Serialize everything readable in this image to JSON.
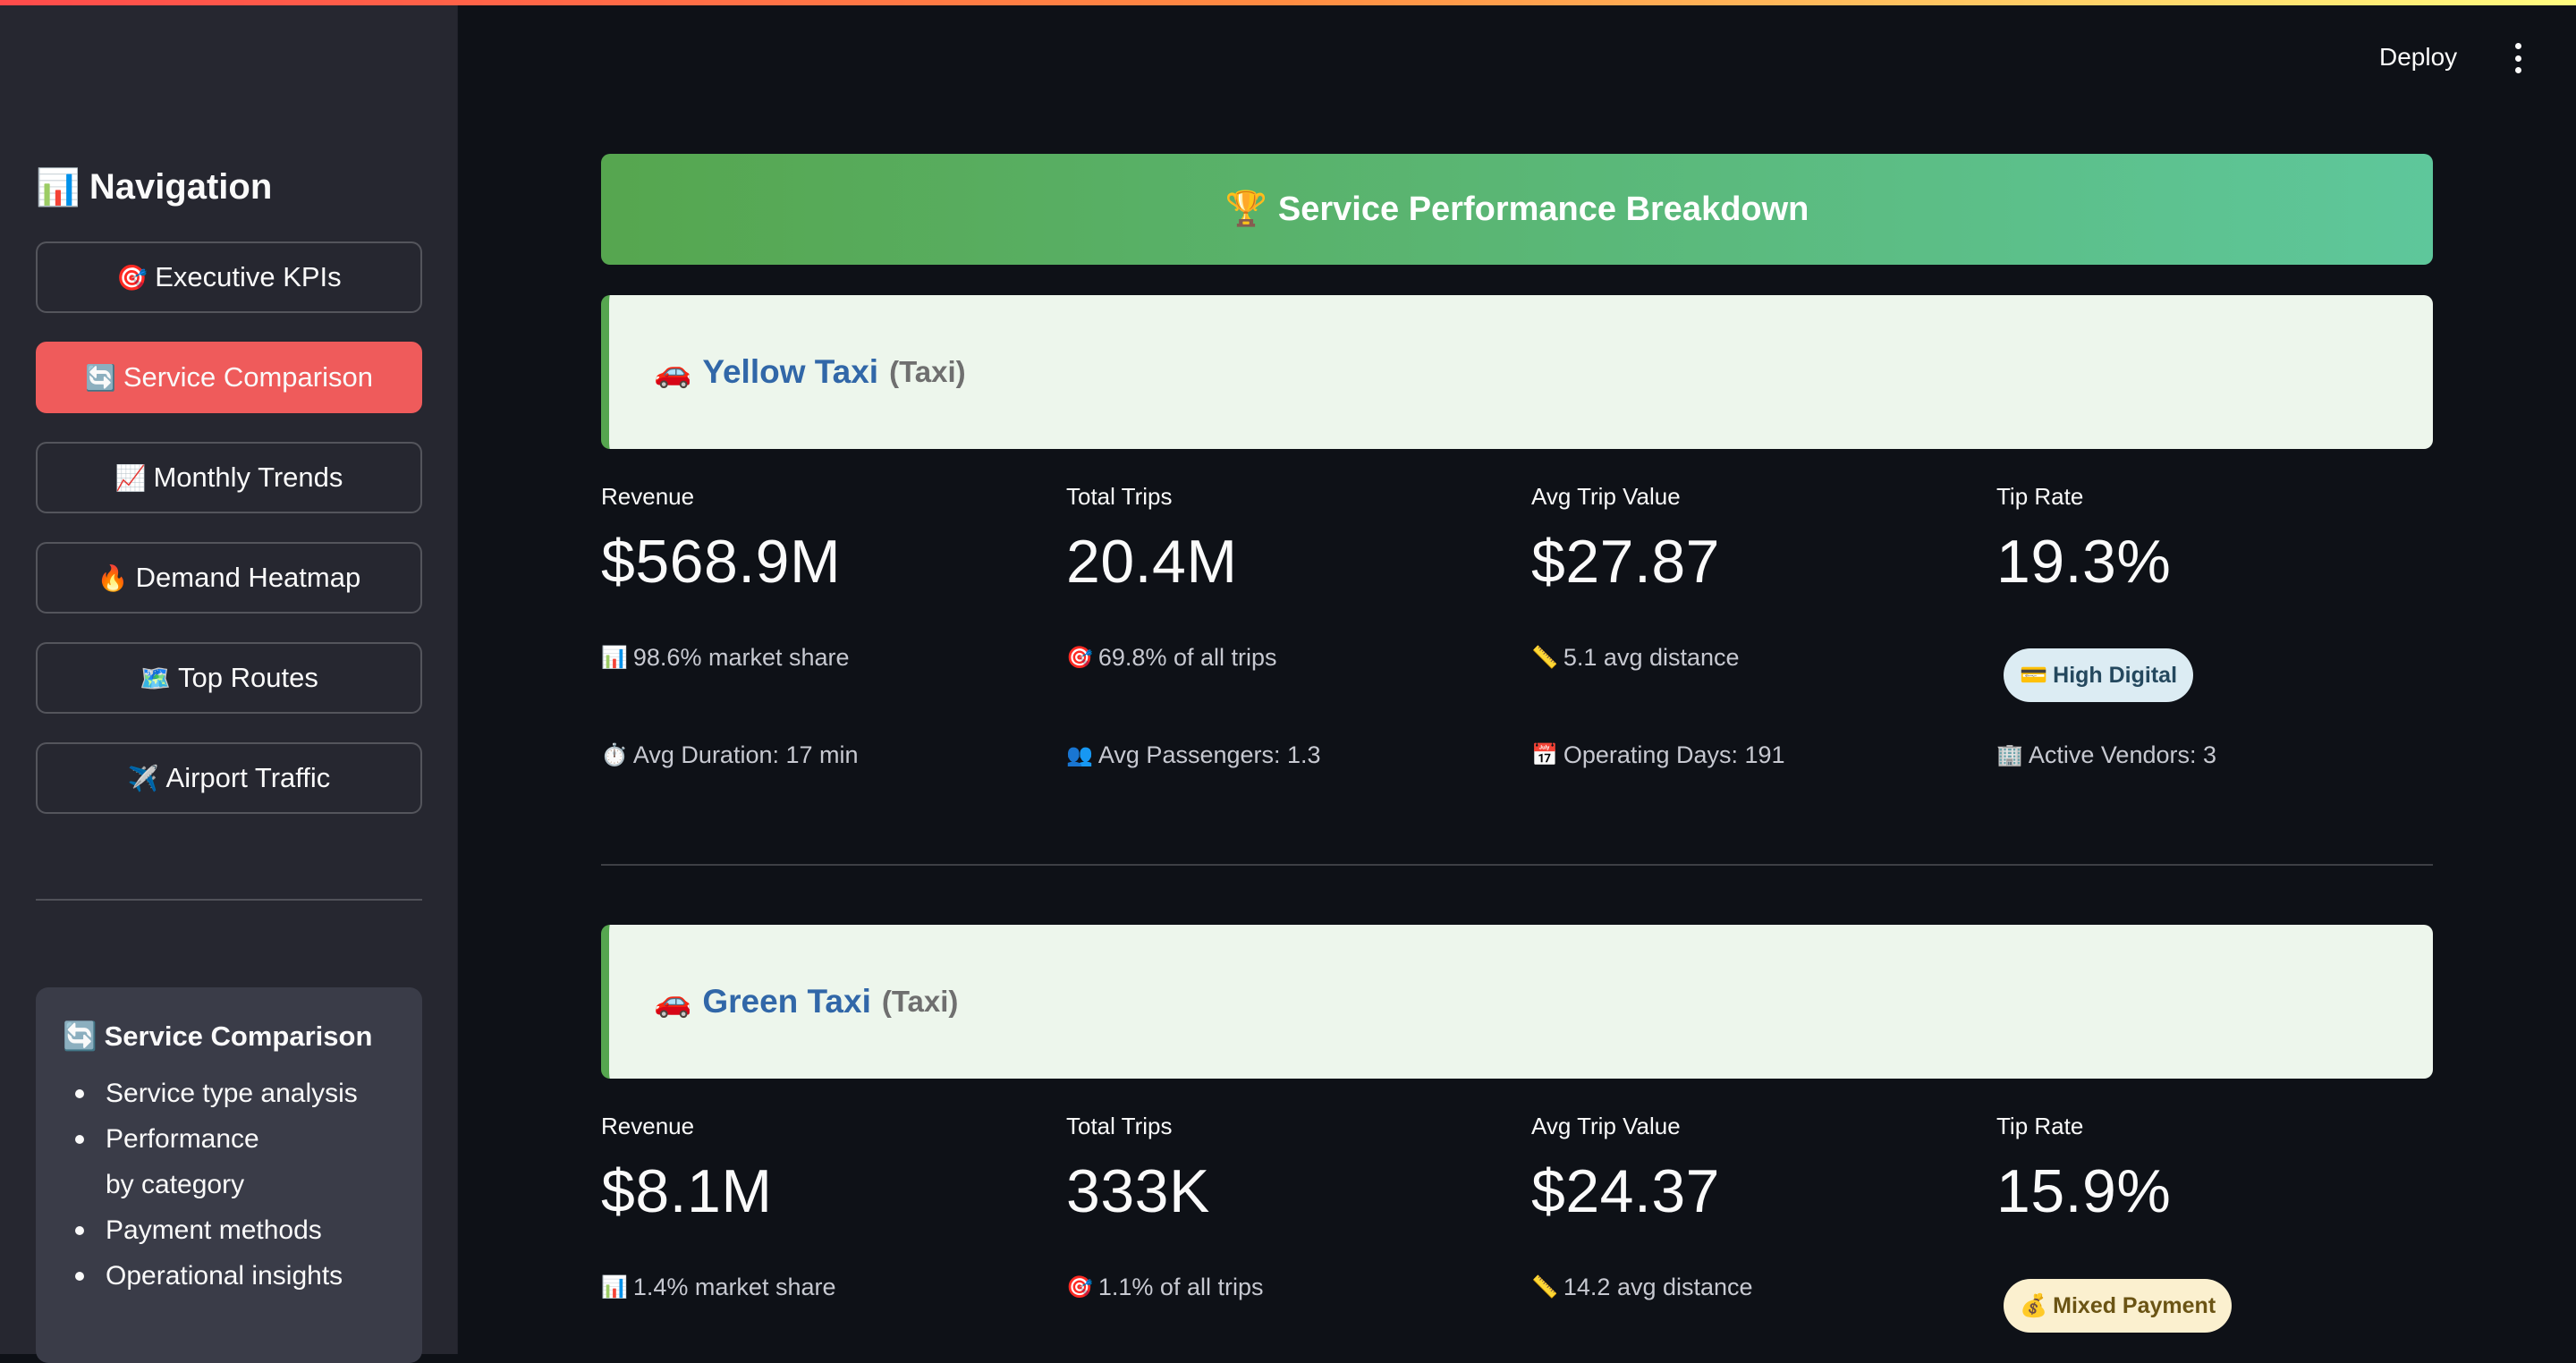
{
  "sidebar": {
    "nav_icon": "📊",
    "nav_title": "Navigation",
    "items": [
      {
        "icon": "🎯",
        "label": "Executive KPIs",
        "active": false
      },
      {
        "icon": "🔄",
        "label": "Service Comparison",
        "active": true
      },
      {
        "icon": "📈",
        "label": "Monthly Trends",
        "active": false
      },
      {
        "icon": "🔥",
        "label": "Demand Heatmap",
        "active": false
      },
      {
        "icon": "🗺️",
        "label": "Top Routes",
        "active": false
      },
      {
        "icon": "✈️",
        "label": "Airport Traffic",
        "active": false
      }
    ],
    "info": {
      "icon": "🔄",
      "title": "Service Comparison",
      "bullets": [
        "Service type analysis",
        "Performance by category",
        "Payment methods",
        "Operational insights"
      ]
    }
  },
  "header": {
    "deploy_label": "Deploy",
    "menu_icon": "kebab-menu-icon"
  },
  "banner": {
    "icon": "🏆",
    "title": "Service Performance Breakdown"
  },
  "colors": {
    "accent": "#ef5b5b",
    "banner_start": "#56a64f",
    "banner_end": "#5ec79b",
    "service_name": "#3167a8"
  },
  "services": [
    {
      "icon": "🚗",
      "name": "Yellow Taxi",
      "type": "(Taxi)",
      "metrics": {
        "revenue_label": "Revenue",
        "revenue": "$568.9M",
        "trips_label": "Total Trips",
        "trips": "20.4M",
        "avg_label": "Avg Trip Value",
        "avg": "$27.87",
        "tip_label": "Tip Rate",
        "tip": "19.3%"
      },
      "subs": {
        "market_icon": "📊",
        "market": "98.6% market share",
        "share_icon": "🎯",
        "share": "69.8% of all trips",
        "distance_icon": "📏",
        "distance": "5.1 avg distance",
        "badge_icon": "💳",
        "badge": "High Digital",
        "duration_icon": "⏱️",
        "duration": "Avg Duration: 17 min",
        "passengers_icon": "👥",
        "passengers": "Avg Passengers: 1.3",
        "days_icon": "📅",
        "days": "Operating Days: 191",
        "vendors_icon": "🏢",
        "vendors": "Active Vendors: 3"
      }
    },
    {
      "icon": "🚗",
      "name": "Green Taxi",
      "type": "(Taxi)",
      "metrics": {
        "revenue_label": "Revenue",
        "revenue": "$8.1M",
        "trips_label": "Total Trips",
        "trips": "333K",
        "avg_label": "Avg Trip Value",
        "avg": "$24.37",
        "tip_label": "Tip Rate",
        "tip": "15.9%"
      },
      "subs": {
        "market_icon": "📊",
        "market": "1.4% market share",
        "share_icon": "🎯",
        "share": "1.1% of all trips",
        "distance_icon": "📏",
        "distance": "14.2 avg distance",
        "badge_icon": "💰",
        "badge": "Mixed Payment"
      }
    }
  ]
}
